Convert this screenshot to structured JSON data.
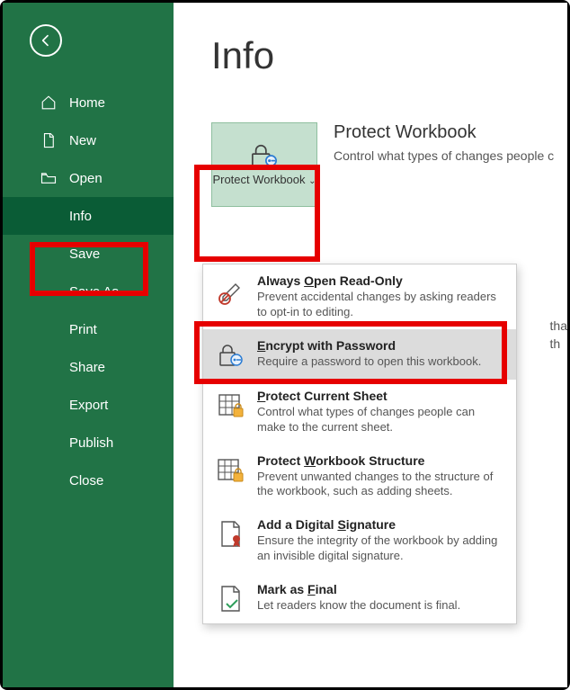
{
  "sidebar": {
    "items": [
      {
        "label": "Home"
      },
      {
        "label": "New"
      },
      {
        "label": "Open"
      },
      {
        "label": "Info"
      },
      {
        "label": "Save"
      },
      {
        "label": "Save As"
      },
      {
        "label": "Print"
      },
      {
        "label": "Share"
      },
      {
        "label": "Export"
      },
      {
        "label": "Publish"
      },
      {
        "label": "Close"
      }
    ]
  },
  "main": {
    "title": "Info",
    "protect_button": "Protect Workbook",
    "section_title": "Protect Workbook",
    "section_desc": "Control what types of changes people c",
    "side_note_1": "tha",
    "side_note_2": "th"
  },
  "dropdown": [
    {
      "title_pre": "Always ",
      "title_ul": "O",
      "title_post": "pen Read-Only",
      "desc": "Prevent accidental changes by asking readers to opt-in to editing."
    },
    {
      "title_pre": "",
      "title_ul": "E",
      "title_post": "ncrypt with Password",
      "desc": "Require a password to open this workbook."
    },
    {
      "title_pre": "",
      "title_ul": "P",
      "title_post": "rotect Current Sheet",
      "desc": "Control what types of changes people can make to the current sheet."
    },
    {
      "title_pre": "Protect ",
      "title_ul": "W",
      "title_post": "orkbook Structure",
      "desc": "Prevent unwanted changes to the structure of the workbook, such as adding sheets."
    },
    {
      "title_pre": "Add a Digital ",
      "title_ul": "S",
      "title_post": "ignature",
      "desc": "Ensure the integrity of the workbook by adding an invisible digital signature."
    },
    {
      "title_pre": "Mark as ",
      "title_ul": "F",
      "title_post": "inal",
      "desc": "Let readers know the document is final."
    }
  ]
}
